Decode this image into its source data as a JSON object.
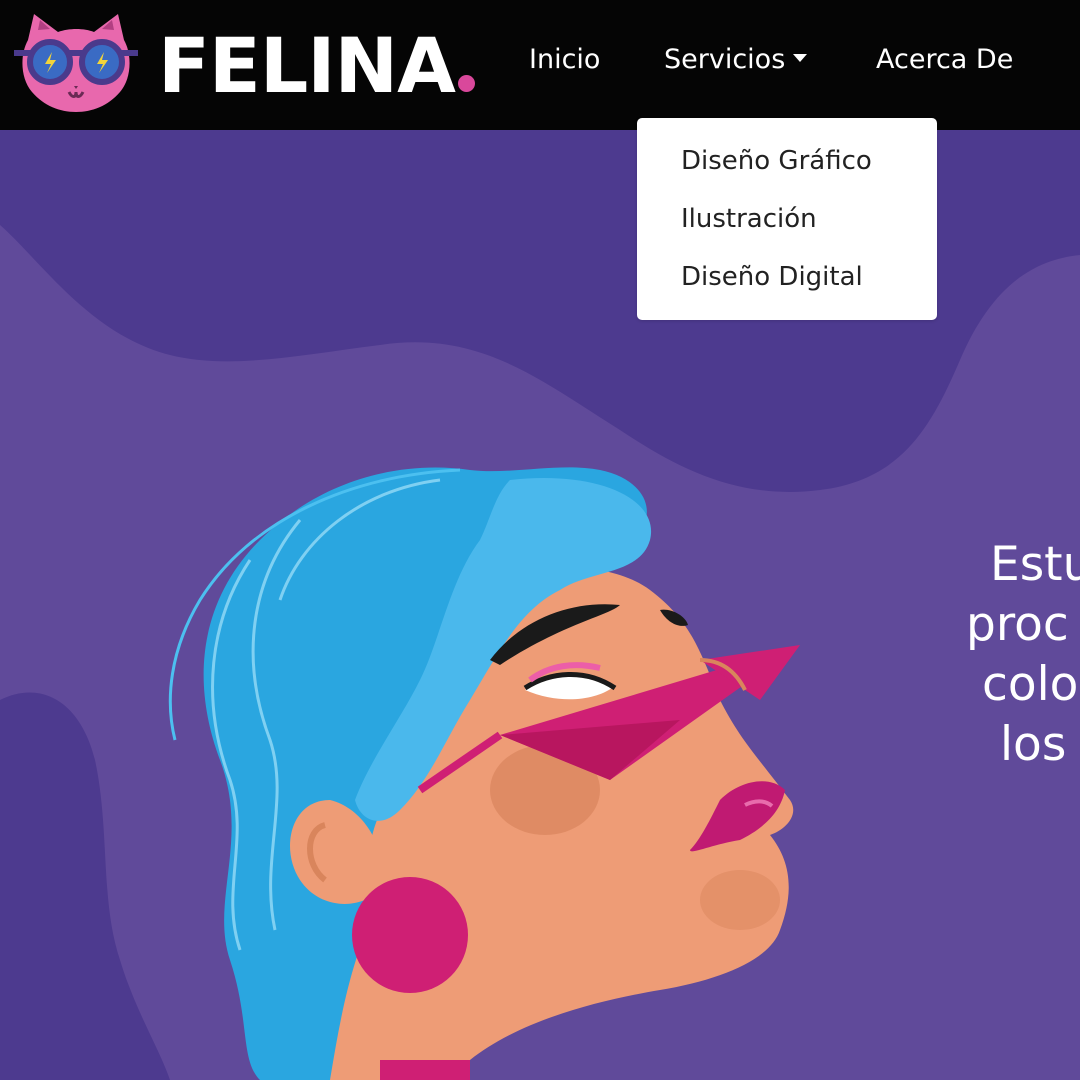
{
  "brand": {
    "name": "FELINA",
    "dot_color": "#d9489b",
    "logo_icon": "cat-with-sunglasses-icon"
  },
  "nav": {
    "items": [
      {
        "label": "Inicio"
      },
      {
        "label": "Servicios",
        "has_dropdown": true
      },
      {
        "label": "Acerca De"
      }
    ]
  },
  "dropdown": {
    "open": true,
    "items": [
      {
        "label": "Diseño Gráfico"
      },
      {
        "label": "Ilustración"
      },
      {
        "label": "Diseño Digital"
      }
    ]
  },
  "hero": {
    "text_lines_visible": [
      "Estu",
      "proc",
      "colo",
      "los"
    ]
  },
  "colors": {
    "navbar_bg": "#050505",
    "hero_bg": "#604a9a",
    "wave_dark": "#4d3a8f",
    "hair": "#2aa6e0",
    "skin": "#ee9c76",
    "accent_pink": "#cf1f74"
  }
}
